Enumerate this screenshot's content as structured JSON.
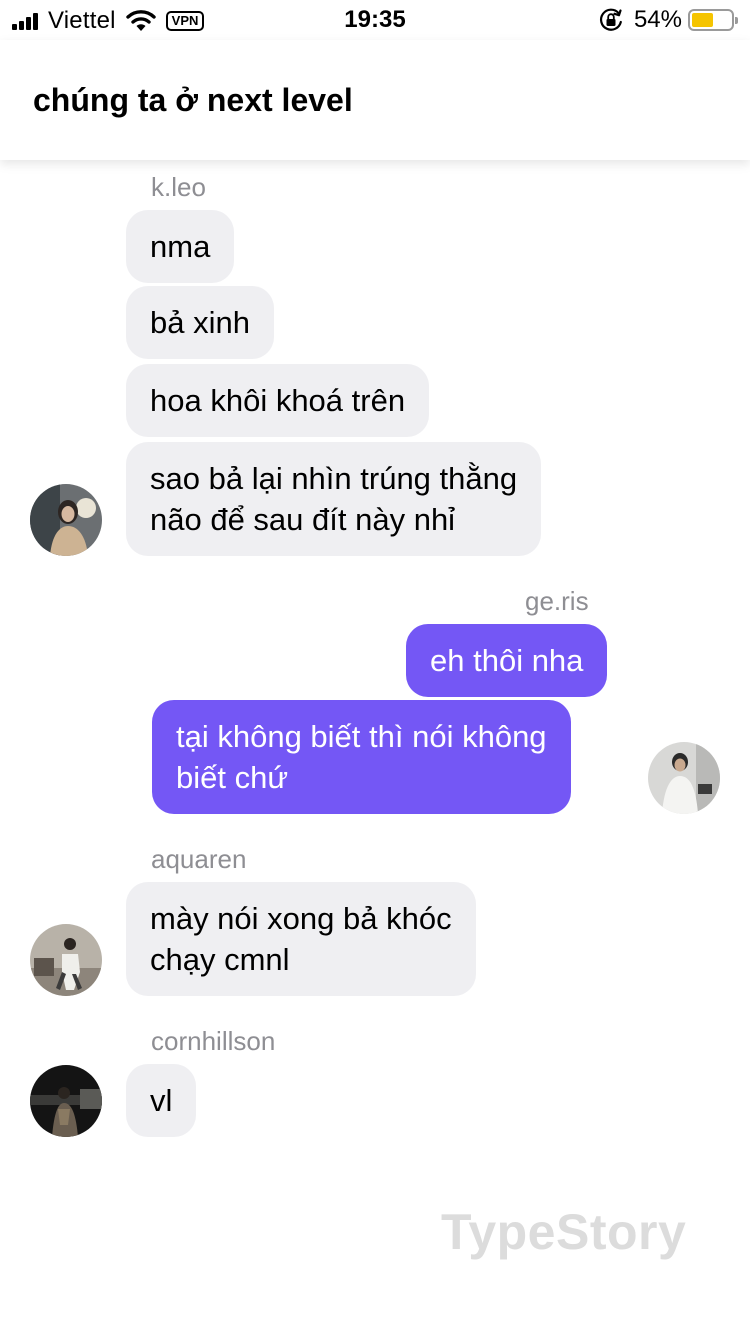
{
  "status_bar": {
    "carrier": "Viettel",
    "vpn": "VPN",
    "time": "19:35",
    "battery_percent": "54%",
    "battery_level": 0.54,
    "battery_color": "#f5c400"
  },
  "header": {
    "title": "chúng ta ở next level"
  },
  "colors": {
    "outgoing_bubble": "#7457f5",
    "incoming_bubble": "#efeff2",
    "sender_name": "#8e8e93"
  },
  "messages": [
    {
      "sender": "k.leo",
      "bubbles": [
        {
          "lines": [
            "nma"
          ]
        },
        {
          "lines": [
            "bả xinh"
          ]
        },
        {
          "lines": [
            "hoa khôi khoá trên"
          ]
        },
        {
          "lines": [
            "sao bả lại nhìn trúng thằng",
            "não để sau đít này nhỉ"
          ]
        }
      ]
    },
    {
      "sender": "ge.ris",
      "bubbles": [
        {
          "lines": [
            "eh thôi nha"
          ]
        },
        {
          "lines": [
            "tại không biết thì nói không",
            "biết chứ"
          ]
        }
      ]
    },
    {
      "sender": "aquaren",
      "bubbles": [
        {
          "lines": [
            "mày nói xong bả khóc",
            "chạy cmnl"
          ]
        }
      ]
    },
    {
      "sender": "cornhillson",
      "bubbles": [
        {
          "lines": [
            "vl"
          ]
        }
      ]
    }
  ],
  "watermark": "TypeStory"
}
